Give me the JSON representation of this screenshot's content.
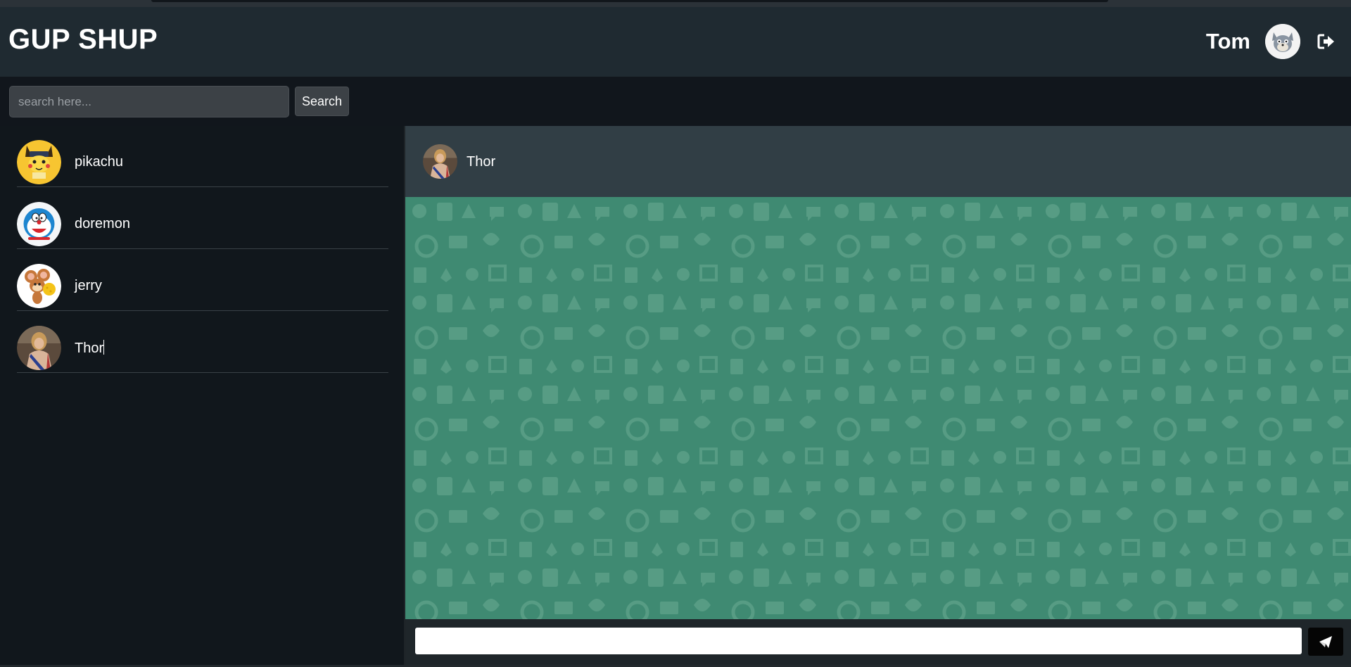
{
  "app": {
    "title": "GUP SHUP"
  },
  "user": {
    "name": "Tom",
    "avatar_icon": "tom-cat-avatar",
    "logout_icon": "sign-out-icon"
  },
  "search": {
    "placeholder": "search here...",
    "value": "",
    "button_label": "Search"
  },
  "contacts": [
    {
      "name": "pikachu",
      "avatar_icon": "pikachu-avatar"
    },
    {
      "name": "doremon",
      "avatar_icon": "doraemon-avatar"
    },
    {
      "name": "jerry",
      "avatar_icon": "jerry-mouse-avatar"
    },
    {
      "name": "Thor",
      "avatar_icon": "thor-avatar"
    }
  ],
  "chat": {
    "contact_name": "Thor",
    "contact_avatar_icon": "thor-avatar",
    "message_value": "",
    "send_icon": "paper-plane-icon"
  },
  "colors": {
    "header_bg": "#1f2a31",
    "sidebar_bg": "#11171c",
    "chat_header_bg": "#313e45",
    "chat_wallpaper": "#3f8a72"
  }
}
